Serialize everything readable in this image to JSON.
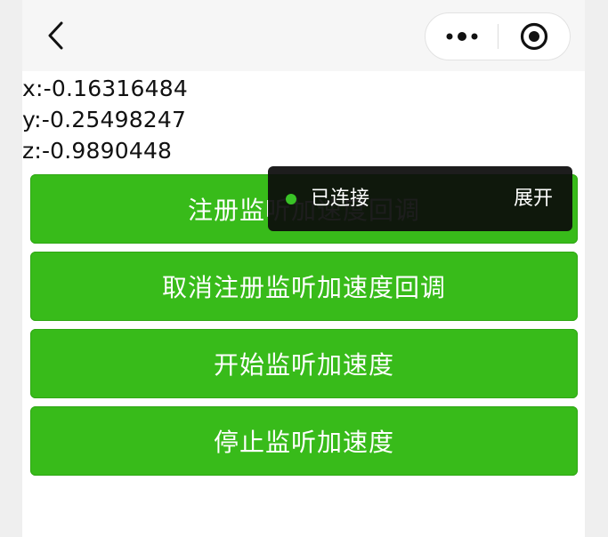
{
  "navbar": {
    "back_icon": "chevron-left-icon",
    "more_icon": "more-dots-icon",
    "close_icon": "target-circle-icon"
  },
  "accelerometer": {
    "x": "x:-0.16316484",
    "y": "y:-0.25498247",
    "z": "z:-0.9890448"
  },
  "buttons": {
    "register": "注册监听加速度回调",
    "unregister": "取消注册监听加速度回调",
    "start": "开始监听加速度",
    "stop": "停止监听加速度"
  },
  "toast": {
    "status": "已连接",
    "expand": "展开",
    "status_color": "#39c326"
  },
  "colors": {
    "primary_button": "#38bb1a",
    "navbar_bg": "#f6f6f6"
  }
}
